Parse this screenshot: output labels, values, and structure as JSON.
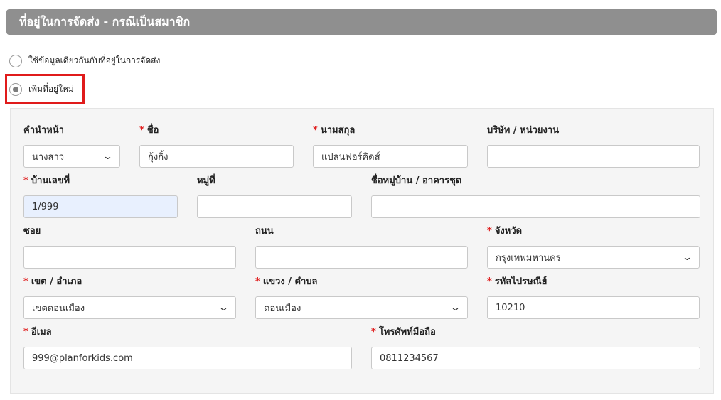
{
  "header": {
    "title": "ที่อยู่ในการจัดส่ง - กรณีเป็นสมาชิก"
  },
  "options": [
    {
      "label": "ใช้ข้อมูลเดียวกันกับที่อยู่ในการจัดส่ง",
      "selected": false
    },
    {
      "label": "เพิ่มที่อยู่ใหม่",
      "selected": true
    }
  ],
  "form": {
    "title_prefix": {
      "label": "คำนำหน้า",
      "value": "นางสาว"
    },
    "first_name": {
      "label": "ชื่อ",
      "value": "กุ้งกิ้ง"
    },
    "last_name": {
      "label": "นามสกุล",
      "value": "แปลนฟอร์คิดส์"
    },
    "company": {
      "label": "บริษัท / หน่วยงาน",
      "value": ""
    },
    "house_no": {
      "label": "บ้านเลขที่",
      "value": "1/999"
    },
    "moo": {
      "label": "หมู่ที่",
      "value": ""
    },
    "village": {
      "label": "ชื่อหมู่บ้าน / อาคารชุด",
      "value": ""
    },
    "soi": {
      "label": "ซอย",
      "value": ""
    },
    "road": {
      "label": "ถนน",
      "value": ""
    },
    "province": {
      "label": "จังหวัด",
      "value": "กรุงเทพมหานคร"
    },
    "district": {
      "label": "เขต / อำเภอ",
      "value": "เขตดอนเมือง"
    },
    "subdistrict": {
      "label": "แขวง / ตำบล",
      "value": "ดอนเมือง"
    },
    "postcode": {
      "label": "รหัสไปรษณีย์",
      "value": "10210"
    },
    "email": {
      "label": "อีเมล",
      "value": "999@planforkids.com"
    },
    "mobile": {
      "label": "โทรศัพท์มือถือ",
      "value": "0811234567"
    }
  },
  "required_mark": "*",
  "colors": {
    "header_bg": "#8f8f8f",
    "required": "#e02020",
    "highlight": "#e01b1b",
    "autofill": "#e8f0fe"
  }
}
